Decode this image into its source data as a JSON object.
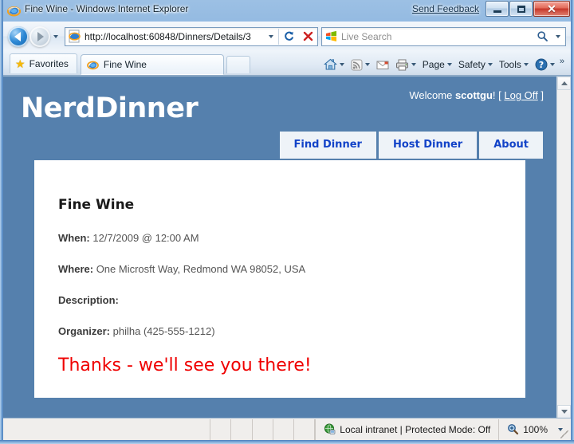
{
  "browser": {
    "title": "Fine Wine - Windows Internet Explorer",
    "send_feedback": "Send Feedback",
    "window_controls": {
      "minimize": "minimize-button",
      "maximize": "maximize-button",
      "close": "✕"
    },
    "address": {
      "url": "http://localhost:60848/Dinners/Details/3",
      "favicon": "ie-icon"
    },
    "search": {
      "placeholder": "Live Search",
      "provider_icon": "windows-live-icon"
    },
    "favorites_label": "Favorites",
    "tab": {
      "label": "Fine Wine"
    },
    "command_bar": [
      {
        "label": "",
        "icon": "home-icon",
        "has_caret": true
      },
      {
        "label": "",
        "icon": "rss-feeds-icon",
        "has_caret": true
      },
      {
        "label": "",
        "icon": "read-mail-icon",
        "has_caret": false
      },
      {
        "label": "",
        "icon": "print-icon",
        "has_caret": true
      },
      {
        "label": "Page",
        "icon": "",
        "has_caret": true
      },
      {
        "label": "Safety",
        "icon": "",
        "has_caret": true
      },
      {
        "label": "Tools",
        "icon": "",
        "has_caret": true
      },
      {
        "label": "",
        "icon": "help-icon",
        "has_caret": true
      }
    ],
    "overflow_label": "»",
    "status": {
      "zone": "Local intranet | Protected Mode: Off",
      "zone_icon": "internet-zone-icon",
      "zoom_level": "100%",
      "zoom_icon": "magnifier-icon"
    }
  },
  "page": {
    "logo": "NerdDinner",
    "welcome_prefix": "Welcome ",
    "username": "scottgu",
    "welcome_suffix": "! [ ",
    "logoff": "Log Off",
    "welcome_end": " ]",
    "nav": [
      {
        "label": "Find Dinner"
      },
      {
        "label": "Host Dinner"
      },
      {
        "label": "About"
      }
    ],
    "dinner": {
      "title": "Fine Wine",
      "when_label": "When:",
      "when_value": "12/7/2009 @ 12:00 AM",
      "where_label": "Where:",
      "where_value": "One Microsft Way, Redmond WA 98052, USA",
      "description_label": "Description:",
      "description_value": "",
      "organizer_label": "Organizer:",
      "organizer_value": "philha (425-555-1212)",
      "thanks_message": "Thanks - we'll see you there!"
    }
  },
  "colors": {
    "page_blue": "#5580ad",
    "nav_tab_bg": "#eef3f8",
    "nav_tab_text": "#1243c8",
    "thanks_red": "#ef0000",
    "chrome_blue": "#4a7ebb"
  }
}
